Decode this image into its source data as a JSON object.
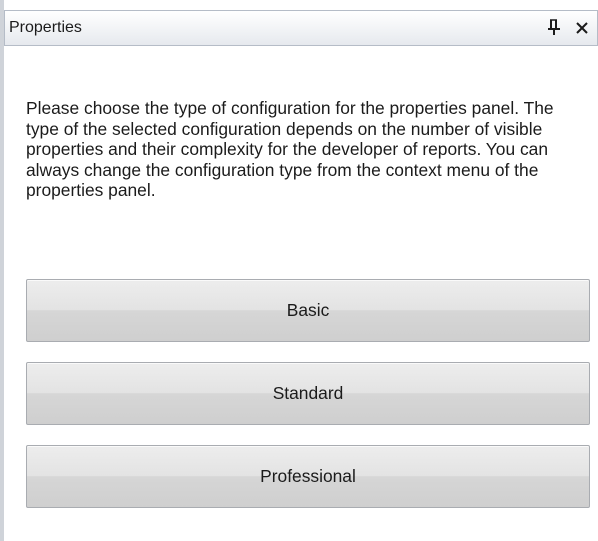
{
  "panel": {
    "title": "Properties",
    "pin_icon": "pin-icon",
    "close_icon": "close-icon"
  },
  "description": "Please choose the type of configuration for the properties panel. The type of the selected configuration depends on the number of visible properties and their complexity for the developer of reports. You can always change the configuration type from the context menu of the properties panel.",
  "buttons": {
    "basic": "Basic",
    "standard": "Standard",
    "professional": "Professional"
  }
}
